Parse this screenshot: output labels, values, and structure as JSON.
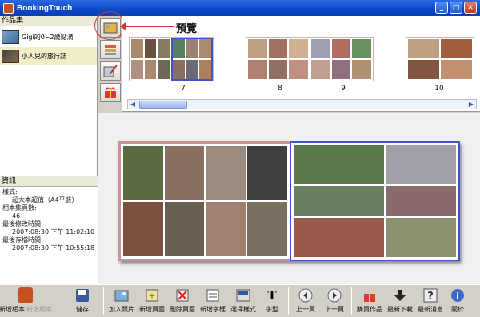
{
  "window": {
    "title": "BookingTouch",
    "min": "_",
    "max": "□",
    "close": "✕"
  },
  "albums": {
    "header": "作品集",
    "items": [
      {
        "label": "Gigi的0~2歲點滴"
      },
      {
        "label": "小人兒的旅行誌"
      }
    ]
  },
  "info": {
    "header": "資訊",
    "lines": [
      {
        "text": "樣式:",
        "indent": false
      },
      {
        "text": "超大本超值（A4平裝）",
        "indent": true
      },
      {
        "text": "相本集頁數:",
        "indent": false
      },
      {
        "text": "46",
        "indent": true
      },
      {
        "text": "最後修改時間:",
        "indent": false
      },
      {
        "text": "2007:08:30 下午 11:02:10",
        "indent": true
      },
      {
        "text": "最後存檔時間:",
        "indent": false
      },
      {
        "text": "2007:08:30 下午 10:55:18",
        "indent": true
      }
    ]
  },
  "preview": {
    "label": "預覽",
    "page_numbers": [
      "7",
      "8",
      "9",
      "10"
    ]
  },
  "tools": [
    {
      "name": "preview-tool",
      "icon": "layout-icon"
    },
    {
      "name": "layers-tool",
      "icon": "stack-icon"
    },
    {
      "name": "edit-tool",
      "icon": "edit-icon"
    },
    {
      "name": "gift-tool",
      "icon": "gift-icon"
    }
  ],
  "toolbar": {
    "new_album": "新增相本",
    "new_album_dim": "新增相本",
    "save": "儲存",
    "add_photo": "加入照片",
    "add_page": "新增頁面",
    "delete_page": "刪除頁面",
    "add_text": "新增字框",
    "choose_style": "選擇樣式",
    "font": "字型",
    "prev_page": "上一頁",
    "next_page": "下一頁",
    "buy": "購買作品",
    "download": "最新下載",
    "news": "最新消息",
    "about": "關於"
  },
  "colors": {
    "selection": "#3e54c8",
    "highlight": "#d23838",
    "titlebar": "#0a46c6"
  }
}
